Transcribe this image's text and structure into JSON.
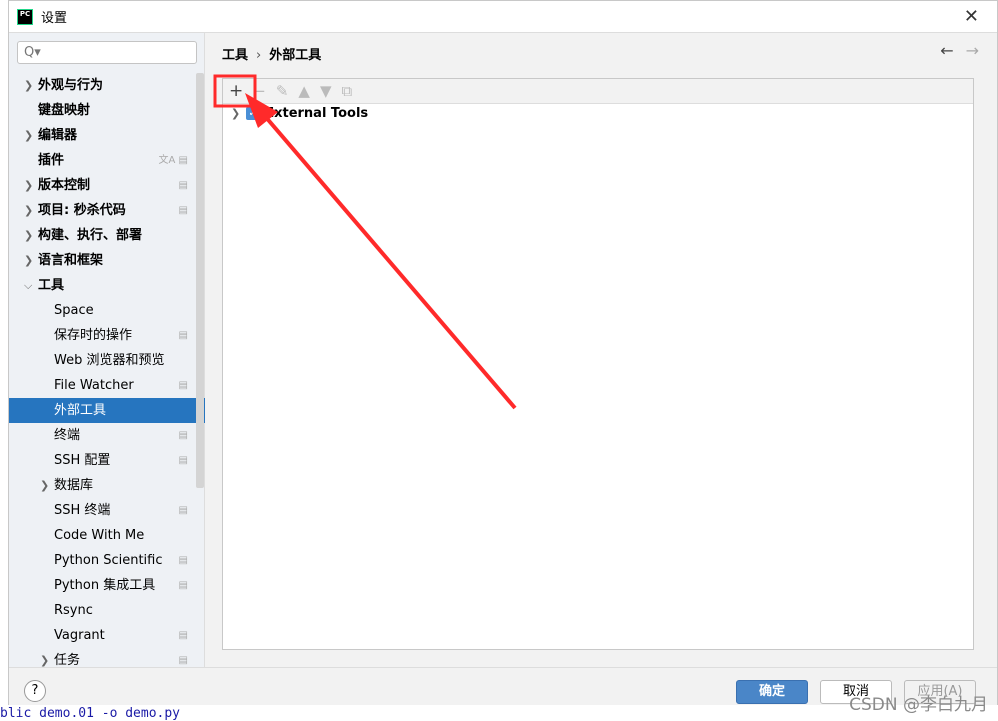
{
  "background_text": "blic demo.01 -o demo.py",
  "window": {
    "logo": "PC",
    "title": "设置",
    "close_icon": "close-icon"
  },
  "search": {
    "placeholder": "Q▾"
  },
  "sidebar": {
    "items": [
      {
        "label": "外观与行为",
        "chev": true,
        "level": 0
      },
      {
        "label": "键盘映射",
        "level": 0
      },
      {
        "label": "编辑器",
        "chev": true,
        "level": 0
      },
      {
        "label": "插件",
        "level": 0,
        "icon": "文A ▤"
      },
      {
        "label": "版本控制",
        "chev": true,
        "level": 0,
        "icon": "▤"
      },
      {
        "label": "项目: 秒杀代码",
        "chev": true,
        "level": 0,
        "icon": "▤"
      },
      {
        "label": "构建、执行、部署",
        "chev": true,
        "level": 0
      },
      {
        "label": "语言和框架",
        "chev": true,
        "level": 0
      },
      {
        "label": "工具",
        "chev": "open",
        "level": 0
      },
      {
        "label": "Space",
        "level": 1
      },
      {
        "label": "保存时的操作",
        "level": 1,
        "icon": "▤"
      },
      {
        "label": "Web 浏览器和预览",
        "level": 1
      },
      {
        "label": "File Watcher",
        "level": 1,
        "icon": "▤"
      },
      {
        "label": "外部工具",
        "level": 1,
        "selected": true
      },
      {
        "label": "终端",
        "level": 1,
        "icon": "▤"
      },
      {
        "label": "SSH 配置",
        "level": 1,
        "icon": "▤"
      },
      {
        "label": "数据库",
        "chev": true,
        "level": 1
      },
      {
        "label": "SSH 终端",
        "level": 1,
        "icon": "▤"
      },
      {
        "label": "Code With Me",
        "level": 1
      },
      {
        "label": "Python Scientific",
        "level": 1,
        "icon": "▤"
      },
      {
        "label": "Python 集成工具",
        "level": 1,
        "icon": "▤"
      },
      {
        "label": "Rsync",
        "level": 1
      },
      {
        "label": "Vagrant",
        "level": 1,
        "icon": "▤"
      },
      {
        "label": "任务",
        "chev": true,
        "level": 1,
        "icon": "▤"
      }
    ]
  },
  "breadcrumb": {
    "parent": "工具",
    "separator": "›",
    "current": "外部工具"
  },
  "nav": {
    "back": "←",
    "forward": "→"
  },
  "toolbar": {
    "add": "+",
    "remove": "−",
    "edit": "✎",
    "up": "▲",
    "down": "▼",
    "copy": "⧉"
  },
  "tree": {
    "label": "External Tools",
    "checked": true
  },
  "footer": {
    "help": "?",
    "ok": "确定",
    "cancel": "取消",
    "apply": "应用(A)"
  },
  "watermark": "CSDN @李白九月",
  "colors": {
    "selection": "#2675bf",
    "annotation": "#ff2a2a",
    "ok_button": "#4a86c8"
  }
}
